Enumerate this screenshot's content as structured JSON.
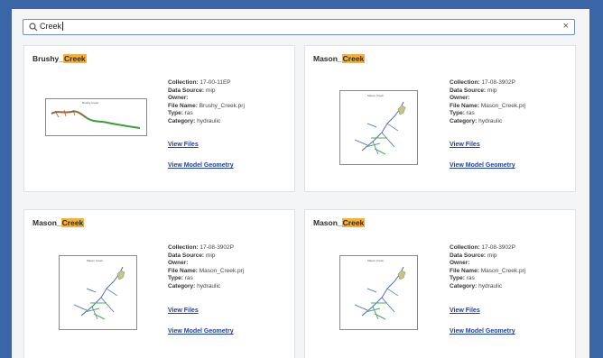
{
  "search": {
    "value": "Creek"
  },
  "labels": {
    "collection": "Collection:",
    "data_source": "Data Source:",
    "owner": "Owner:",
    "file_name": "File Name:",
    "type": "Type:",
    "category": "Category:"
  },
  "cards": [
    {
      "title_prefix": "Brushy_",
      "title_match": "Creek",
      "thumb_title": "Brushy Creek",
      "collection": "17-00-11EP",
      "data_source": "mip",
      "owner": "",
      "file_name": "Brushy_Creek.prj",
      "type": "ras",
      "category": "hydraulic",
      "view_files": "View Files",
      "view_geometry": "View Model Geometry"
    },
    {
      "title_prefix": "Mason_",
      "title_match": "Creek",
      "thumb_title": "Mason Creek",
      "collection": "17-08-3902P",
      "data_source": "mip",
      "owner": "",
      "file_name": "Mason_Creek.prj",
      "type": "ras",
      "category": "hydraulic",
      "view_files": "View Files",
      "view_geometry": "View Model Geometry"
    },
    {
      "title_prefix": "Mason_",
      "title_match": "Creek",
      "thumb_title": "Mason Creek",
      "collection": "17-08-3902P",
      "data_source": "mip",
      "owner": "",
      "file_name": "Mason_Creek.prj",
      "type": "ras",
      "category": "hydraulic",
      "view_files": "View Files",
      "view_geometry": "View Model Geometry"
    },
    {
      "title_prefix": "Mason_",
      "title_match": "Creek",
      "thumb_title": "Mason Creek",
      "collection": "17-08-3902P",
      "data_source": "mip",
      "owner": "",
      "file_name": "Mason_Creek.prj",
      "type": "ras",
      "category": "hydraulic",
      "view_files": "View Files",
      "view_geometry": "View Model Geometry"
    }
  ]
}
